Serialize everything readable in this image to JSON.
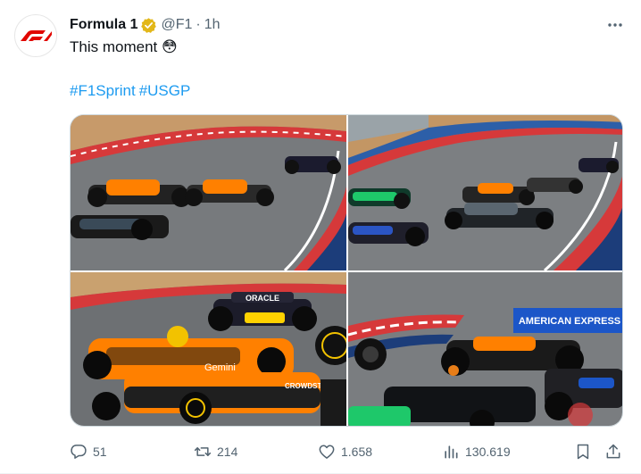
{
  "tweet": {
    "author_name": "Formula 1",
    "handle": "@F1",
    "separator": "·",
    "time": "1h",
    "text": "This moment 😳",
    "hashtags": [
      "#F1Sprint",
      "#USGP"
    ],
    "photos": [
      {
        "name": "photo-cars-cornering-1"
      },
      {
        "name": "photo-cars-cornering-2"
      },
      {
        "name": "photo-mclaren-closeup"
      },
      {
        "name": "photo-wheel-debris"
      }
    ],
    "photo_text": {
      "oracle": "ORACLE",
      "gemini": "Gemini",
      "crowdstrike": "CROWDSTRIKE",
      "amex": "AMERICAN EXPRESS"
    }
  },
  "actions": {
    "replies": "51",
    "retweets": "214",
    "likes": "1.658",
    "views": "130.619"
  },
  "icons": {
    "avatar": "formula1-logo",
    "verified": "verified-badge-gold",
    "more": "more-icon",
    "reply": "reply-icon",
    "retweet": "retweet-icon",
    "like": "heart-icon",
    "views": "views-icon",
    "bookmark": "bookmark-icon",
    "share": "share-icon"
  },
  "colors": {
    "text_primary": "#0f1419",
    "text_secondary": "#536471",
    "link": "#1d9bf0",
    "f1_red": "#e10600",
    "verified_gold": "#e2b719"
  }
}
